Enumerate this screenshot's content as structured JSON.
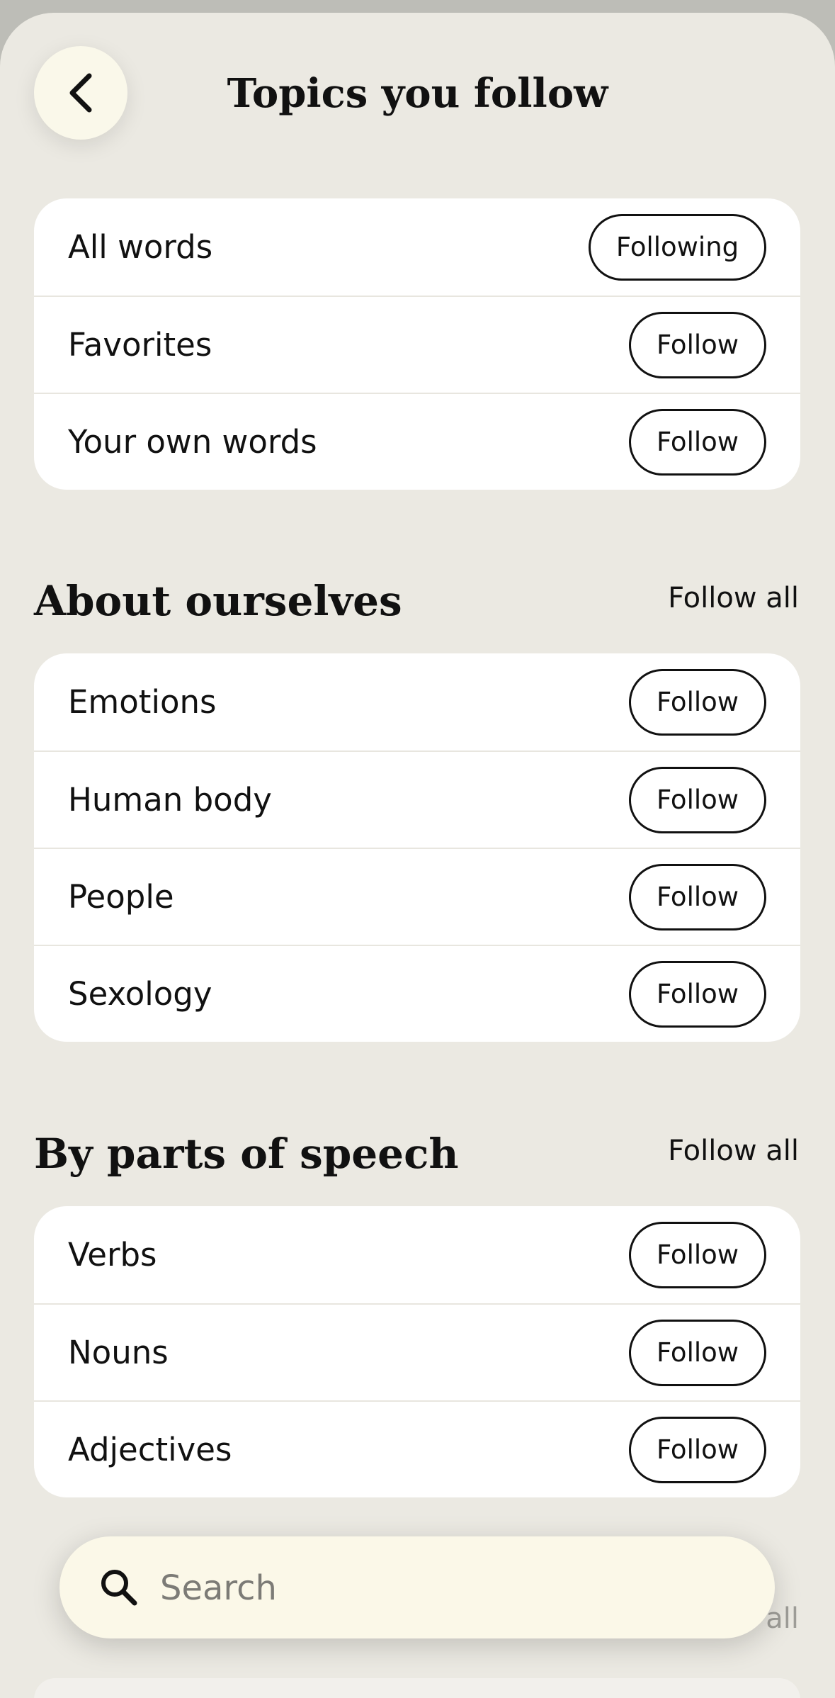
{
  "header": {
    "title": "Topics you follow"
  },
  "icons": {
    "back": "chevron-left-icon",
    "search": "search-icon"
  },
  "general": {
    "items": [
      {
        "label": "All words",
        "action": "Following"
      },
      {
        "label": "Favorites",
        "action": "Follow"
      },
      {
        "label": "Your own words",
        "action": "Follow"
      }
    ]
  },
  "about_ourselves": {
    "title": "About ourselves",
    "follow_all": "Follow all",
    "items": [
      {
        "label": "Emotions",
        "action": "Follow"
      },
      {
        "label": "Human body",
        "action": "Follow"
      },
      {
        "label": "People",
        "action": "Follow"
      },
      {
        "label": "Sexology",
        "action": "Follow"
      }
    ]
  },
  "parts_of_speech": {
    "title": "By parts of speech",
    "follow_all": "Follow all",
    "items": [
      {
        "label": "Verbs",
        "action": "Follow"
      },
      {
        "label": "Nouns",
        "action": "Follow"
      },
      {
        "label": "Adjectives",
        "action": "Follow"
      }
    ]
  },
  "next_section": {
    "follow_all": "all"
  },
  "search": {
    "placeholder": "Search"
  }
}
